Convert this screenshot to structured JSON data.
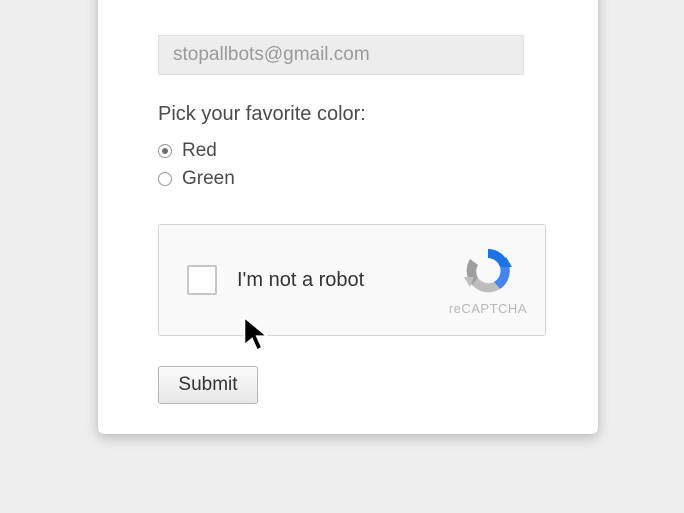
{
  "email": {
    "value": "stopallbots@gmail.com"
  },
  "question": "Pick your favorite color:",
  "options": [
    {
      "label": "Red",
      "checked": true
    },
    {
      "label": "Green",
      "checked": false
    }
  ],
  "captcha": {
    "label": "I'm not a robot",
    "brand": "reCAPTCHA"
  },
  "submit_label": "Submit"
}
